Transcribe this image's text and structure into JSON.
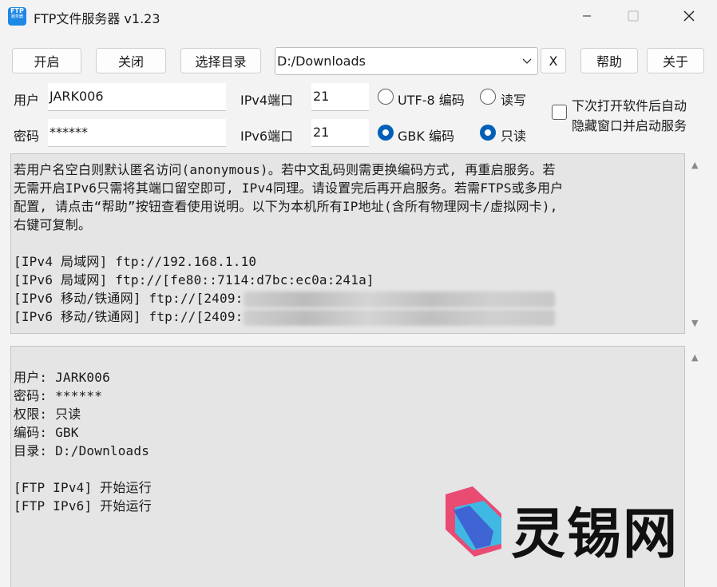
{
  "window": {
    "app_icon_text": "FTP",
    "app_icon_subtext": "服务器",
    "title": "FTP文件服务器 v1.23"
  },
  "toolbar": {
    "start_label": "开启",
    "close_label": "关闭",
    "select_dir_label": "选择目录",
    "directory_value": "D:/Downloads",
    "clear_label": "X",
    "help_label": "帮助",
    "about_label": "关于"
  },
  "form": {
    "user_label": "用户",
    "user_value": "JARK006",
    "password_label": "密码",
    "password_value": "******",
    "ipv4_port_label": "IPv4端口",
    "ipv4_port_value": "21",
    "ipv6_port_label": "IPv6端口",
    "ipv6_port_value": "21",
    "encoding_options": [
      {
        "label": "UTF-8 编码",
        "selected": false
      },
      {
        "label": "GBK 编码",
        "selected": true
      }
    ],
    "permission_options": [
      {
        "label": "读写",
        "selected": false
      },
      {
        "label": "只读",
        "selected": true
      }
    ],
    "autostart_label_line1": "下次打开软件后自动",
    "autostart_label_line2": "隐藏窗口并启动服务",
    "autostart_checked": false
  },
  "info_box": {
    "lines": [
      "若用户名空白则默认匿名访问(anonymous)。若中文乱码则需更换编码方式, 再重启服务。若",
      "无需开启IPv6只需将其端口留空即可, IPv4同理。请设置完后再开启服务。若需FTPS或多用户",
      "配置, 请点击“帮助”按钮查看使用说明。以下为本机所有IP地址(含所有物理网卡/虚拟网卡),",
      "右键可复制。",
      "",
      "[IPv4 局域网] ftp://192.168.1.10",
      "[IPv6 局域网] ftp://[fe80::7114:d7bc:ec0a:241a]",
      "[IPv6 移动/铁通网] ftp://[2409:",
      "[IPv6 移动/铁通网] ftp://[2409:"
    ]
  },
  "log_box": {
    "lines": [
      "",
      "用户: JARK006",
      "密码: ******",
      "权限: 只读",
      "编码: GBK",
      "目录: D:/Downloads",
      "",
      "[FTP IPv4] 开始运行",
      "[FTP IPv6] 开始运行"
    ]
  },
  "watermark": {
    "text": "灵锡网"
  },
  "colors": {
    "accent": "#005fb8",
    "window_bg": "#f3f3f3",
    "textbox_bg": "#e5e5e5",
    "logo_pink": "#e94b73",
    "logo_blue": "#2f6fd6",
    "logo_cyan": "#2ec4f1"
  }
}
